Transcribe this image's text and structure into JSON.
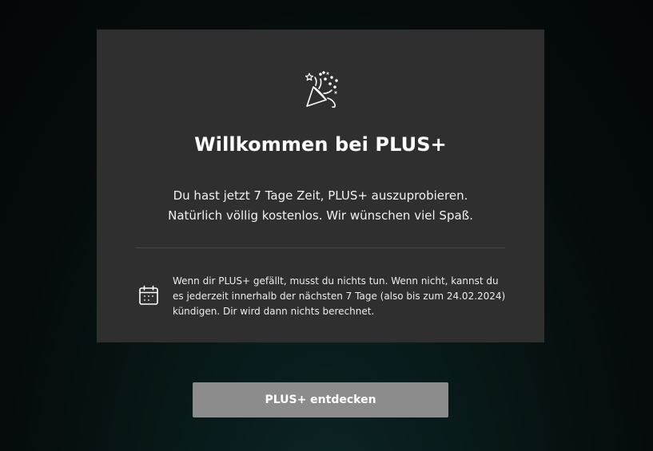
{
  "welcome_card": {
    "icon": "party-popper-icon",
    "title": "Willkommen bei PLUS+",
    "subtitle_line1": "Du hast jetzt 7 Tage Zeit, PLUS+ auszuprobieren.",
    "subtitle_line2": "Natürlich völlig kostenlos. Wir wünschen viel Spaß.",
    "notice_icon": "calendar-icon",
    "notice_text": "Wenn dir PLUS+ gefällt, musst du nichts tun. Wenn nicht, kannst du es jederzeit innerhalb der nächsten 7 Tage (also bis zum 24.02.2024) kündigen. Dir wird dann nichts berechnet."
  },
  "cta": {
    "label": "PLUS+ entdecken"
  },
  "colors": {
    "card_background": "#2f2f2f",
    "button_background": "#8c8c8c",
    "text": "#ffffff"
  }
}
